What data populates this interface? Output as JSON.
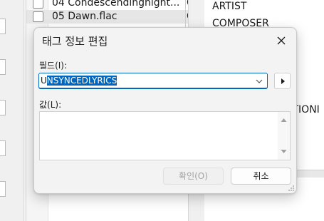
{
  "background": {
    "file_list": [
      {
        "name": "04 Condescendingnight...",
        "col2": "C",
        "selected": false
      },
      {
        "name": "05 Dawn.flac",
        "col2": "C",
        "selected": true
      }
    ],
    "field_names": [
      "ARTIST",
      "COMPOSER"
    ],
    "truncated_field": "ATIONI"
  },
  "dialog": {
    "title": "태그 정보 편집",
    "close_icon": "close-icon",
    "field_label": "필드(I):",
    "field_value_first": "U",
    "field_value_selected": "NSYNCEDLYRICS",
    "field_dropdown_icon": "chevron-down-icon",
    "next_icon": "triangle-right-icon",
    "value_label": "값(L):",
    "value_text": "",
    "ok_label": "확인(O)",
    "cancel_label": "취소",
    "accent_color": "#0067c0"
  }
}
